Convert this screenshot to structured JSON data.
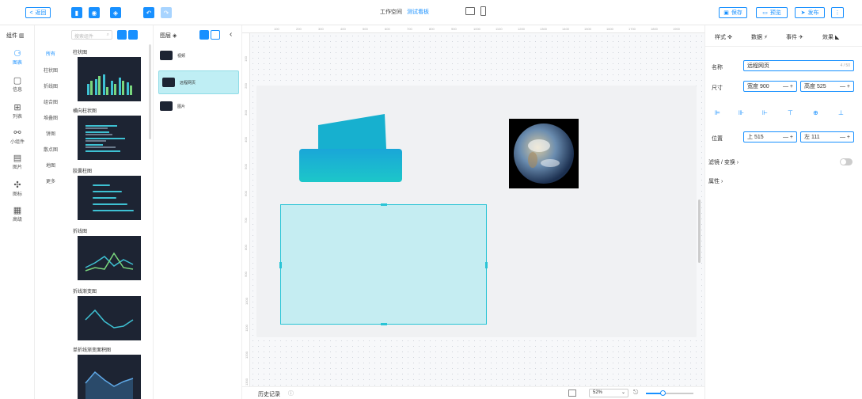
{
  "topbar": {
    "back": "返回",
    "workspace": "工作空间",
    "board_name": "测试看板",
    "save": "保存",
    "preview": "预览",
    "publish": "发布"
  },
  "nav": {
    "header": "组件",
    "items": [
      {
        "label": "图表",
        "icon": "chart-icon"
      },
      {
        "label": "信息",
        "icon": "info-icon"
      },
      {
        "label": "列表",
        "icon": "list-icon"
      },
      {
        "label": "小组件",
        "icon": "widget-icon"
      },
      {
        "label": "图片",
        "icon": "image-icon"
      },
      {
        "label": "图标",
        "icon": "icon-icon"
      },
      {
        "label": "高级",
        "icon": "advanced-icon"
      }
    ]
  },
  "subnav": [
    "所有",
    "柱状图",
    "折线图",
    "组合图",
    "堆叠图",
    "饼图",
    "散点图",
    "地图",
    "更多"
  ],
  "search": {
    "placeholder": "搜索组件"
  },
  "cards": [
    {
      "label": "柱状图"
    },
    {
      "label": "横向柱状图"
    },
    {
      "label": "胶囊柱图"
    },
    {
      "label": "折线图"
    },
    {
      "label": "折线渐变图"
    },
    {
      "label": "单折线渐变面积图"
    }
  ],
  "layers": {
    "header": "图层",
    "items": [
      {
        "label": "视频"
      },
      {
        "label": "远程网页"
      },
      {
        "label": "图片"
      }
    ]
  },
  "ruler_h": [
    "100",
    "200",
    "300",
    "400",
    "500",
    "600",
    "700",
    "800",
    "900",
    "1000",
    "1100",
    "1200",
    "1300",
    "1400",
    "1500",
    "1600",
    "1700",
    "1800",
    "1900"
  ],
  "ruler_v": [
    "100",
    "200",
    "300",
    "400",
    "500",
    "600",
    "700",
    "800",
    "900",
    "1000",
    "1100",
    "1200",
    "1300"
  ],
  "footer": {
    "history": "历史记录",
    "zoom": "52%"
  },
  "right": {
    "tabs": [
      "样式",
      "数据",
      "事件",
      "效果"
    ],
    "name_label": "名称",
    "name_value": "远程网页",
    "name_count": "4 / 50",
    "size_label": "尺寸",
    "width": "宽度 900",
    "height": "高度 525",
    "pos_label": "位置",
    "top": "上 515",
    "left": "左 111",
    "filter": "滤镜 / 变换",
    "attr": "属性"
  }
}
